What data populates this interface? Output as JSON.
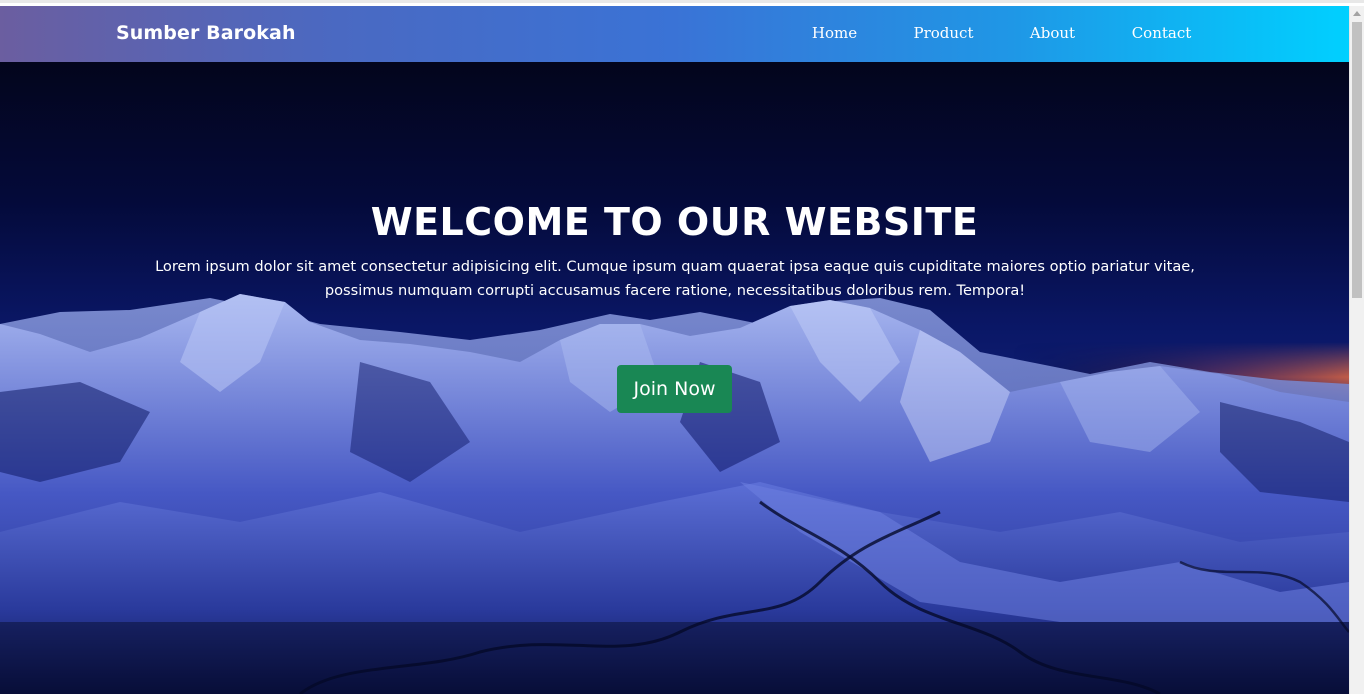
{
  "navbar": {
    "brand": "Sumber Barokah",
    "links": [
      {
        "label": "Home"
      },
      {
        "label": "Product"
      },
      {
        "label": "About"
      },
      {
        "label": "Contact"
      }
    ]
  },
  "hero": {
    "title": "WELCOME TO OUR WEBSITE",
    "text": "Lorem ipsum dolor sit amet consectetur adipisicing elit. Cumque ipsum quam quaerat ipsa eaque quis cupiditate maiores optio pariatur vitae, possimus numquam corrupti accusamus facere ratione, necessitatibus doloribus rem. Tempora!",
    "button_label": "Join Now"
  },
  "colors": {
    "button": "#198754",
    "nav_gradient_start": "#6b5ea0",
    "nav_gradient_end": "#00d0ff",
    "hero_sky": "#040a3a"
  },
  "icons": {
    "scroll_up": "scroll-up-arrow-icon"
  }
}
